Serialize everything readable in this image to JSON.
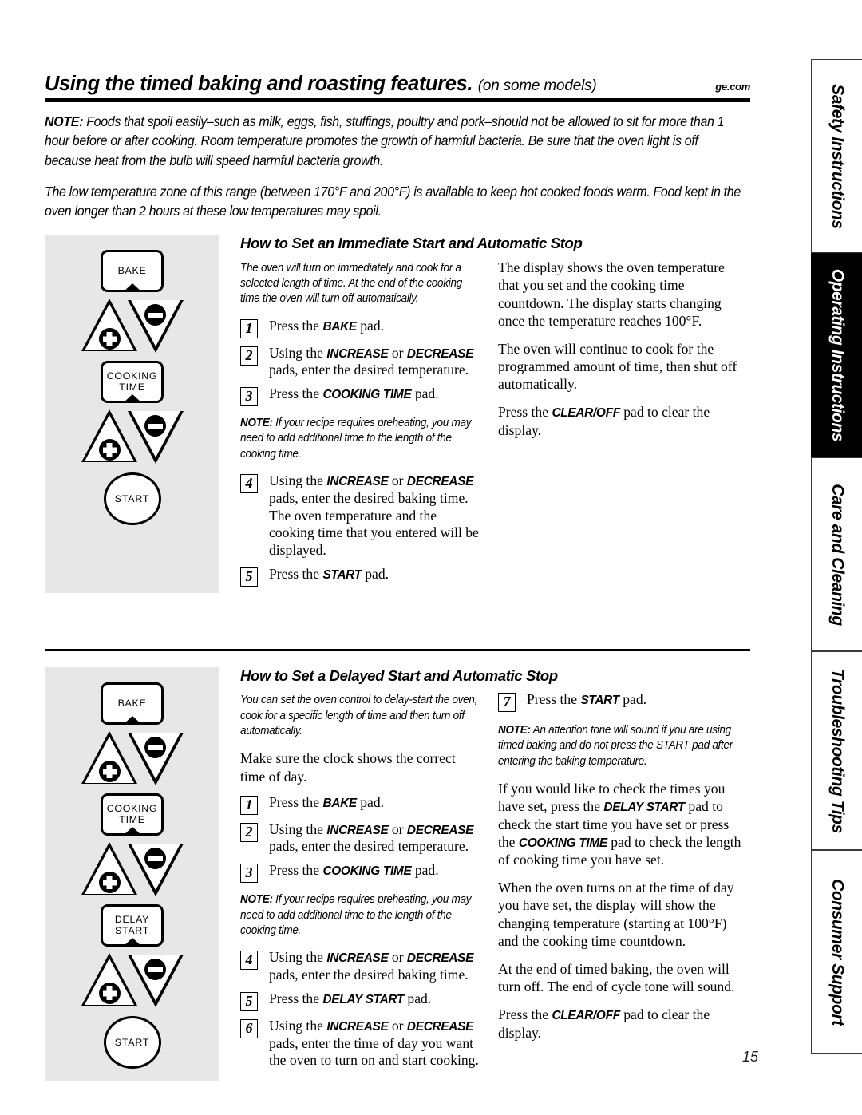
{
  "header": {
    "title": "Using the timed baking and roasting features.",
    "subtitle": "(on some models)",
    "site": "ge.com"
  },
  "intro": {
    "note_label": "NOTE:",
    "note_text": " Foods that spoil easily–such as milk, eggs, fish, stuffings, poultry and pork–should not be allowed to sit for more than 1 hour before or after cooking. Room temperature promotes the growth of harmful bacteria. Be sure that the oven light is off because heat from the bulb will speed harmful bacteria growth.",
    "paragraph2": "The low temperature zone of this range (between 170°F and 200°F) is available to keep hot cooked foods warm. Food kept in the oven longer than 2 hours at these low temperatures may spoil."
  },
  "section1": {
    "title": "How to Set an Immediate Start and Automatic Stop",
    "blurb": "The oven will turn on immediately and cook for a selected length of time. At the end of the cooking time the oven will turn off automatically.",
    "steps": [
      {
        "num": "1",
        "pre": "Press the ",
        "pad": "BAKE",
        "post": " pad."
      },
      {
        "num": "2",
        "pre": "Using the ",
        "pad": "INCREASE",
        "mid": " or ",
        "pad2": "DECREASE",
        "post": " pads, enter the desired temperature."
      },
      {
        "num": "3",
        "pre": "Press the ",
        "pad": "COOKING TIME",
        "post": " pad."
      },
      {
        "num": "4",
        "pre": "Using the ",
        "pad": "INCREASE",
        "mid": " or ",
        "pad2": "DECREASE",
        "post": " pads, enter the desired baking time. The oven temperature and the cooking time that you entered will be displayed."
      },
      {
        "num": "5",
        "pre": "Press the ",
        "pad": "START",
        "post": " pad."
      }
    ],
    "note_label": "NOTE:",
    "note_text": " If your recipe requires preheating, you may need to add additional time to the length of the cooking time.",
    "right_p1": "The display shows the oven temperature that you set and the cooking time countdown. The display starts changing once the temperature reaches 100°F.",
    "right_p2": "The oven will continue to cook for the programmed amount of time, then shut off automatically.",
    "right_p3_pre": "Press the ",
    "right_p3_pad": "CLEAR/OFF",
    "right_p3_post": " pad to clear the display.",
    "diagram_keys": [
      "BAKE",
      "COOKING",
      "TIME",
      "START"
    ]
  },
  "section2": {
    "title": "How to Set a Delayed Start and Automatic Stop",
    "blurb": "You can set the oven control to delay-start the oven, cook for a specific length of time and then turn off automatically.",
    "lead": "Make sure the clock shows the correct time of day.",
    "steps": [
      {
        "num": "1",
        "pre": "Press the ",
        "pad": "BAKE",
        "post": " pad."
      },
      {
        "num": "2",
        "pre": "Using the ",
        "pad": "INCREASE",
        "mid": " or ",
        "pad2": "DECREASE",
        "post": " pads, enter the desired temperature."
      },
      {
        "num": "3",
        "pre": "Press the ",
        "pad": "COOKING TIME",
        "post": " pad."
      },
      {
        "num": "4",
        "pre": "Using the ",
        "pad": "INCREASE",
        "mid": " or ",
        "pad2": "DECREASE",
        "post": " pads, enter the desired baking time."
      },
      {
        "num": "5",
        "pre": "Press the ",
        "pad": "DELAY START",
        "post": " pad."
      },
      {
        "num": "6",
        "pre": "Using the ",
        "pad": "INCREASE",
        "mid": " or ",
        "pad2": "DECREASE",
        "post": " pads, enter the time of day you want the oven to turn on and start cooking."
      },
      {
        "num": "7",
        "pre": "Press the ",
        "pad": "START",
        "post": " pad."
      }
    ],
    "note_label": "NOTE:",
    "note_text": " If your recipe requires preheating, you may need to add additional time to the length of the cooking time.",
    "note2_label": "NOTE:",
    "note2_text": " An attention tone will sound if you are using timed baking and do not press the START pad after entering the baking temperature.",
    "right_p2_a": "If you would like to check the times you have set, press the ",
    "right_p2_pad1": "DELAY START",
    "right_p2_b": " pad to check the start time you have set or press the ",
    "right_p2_pad2": "COOKING TIME",
    "right_p2_c": " pad to check the length of cooking time you have set.",
    "right_p3": "When the oven turns on at the time of day you have set, the display will show the changing temperature (starting at 100°F) and the cooking time countdown.",
    "right_p4": "At the end of timed baking, the oven will turn off. The end of cycle tone will sound.",
    "right_p5_pre": "Press the ",
    "right_p5_pad": "CLEAR/OFF",
    "right_p5_post": " pad to clear the display.",
    "diagram_keys": [
      "BAKE",
      "COOKING",
      "TIME",
      "DELAY",
      "START",
      "START"
    ]
  },
  "tabs": [
    {
      "label": "Safety Instructions",
      "active": false
    },
    {
      "label": "Operating Instructions",
      "active": true
    },
    {
      "label": "Care and Cleaning",
      "active": false
    },
    {
      "label": "Troubleshooting Tips",
      "active": false
    },
    {
      "label": "Consumer Support",
      "active": false
    }
  ],
  "page_number": "15",
  "colors": {
    "panel_gray": "#e7e7e7",
    "ink": "#000000",
    "active_tab_bg": "#000000"
  }
}
